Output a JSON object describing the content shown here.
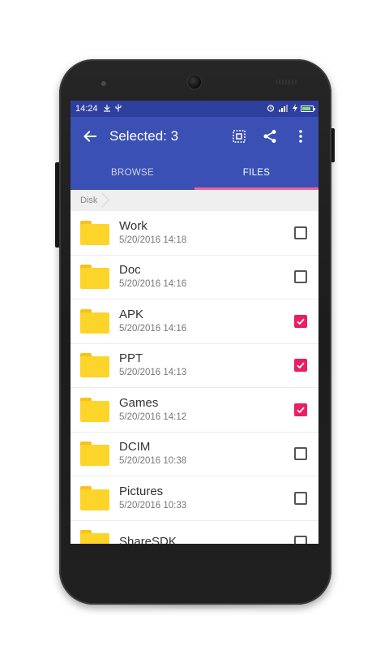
{
  "status_bar": {
    "time": "14:24",
    "left_icons": [
      "usb-icon",
      "usb-debug-icon"
    ],
    "right_icons": [
      "alarm-icon",
      "signal-icon",
      "charging-icon",
      "battery-icon"
    ],
    "battery_fill_fraction": 0.85
  },
  "app_bar": {
    "title": "Selected: 3",
    "actions": [
      "select-all-icon",
      "share-icon",
      "more-vert-icon"
    ]
  },
  "tabs": [
    {
      "label": "BROWSE",
      "active": false
    },
    {
      "label": "FILES",
      "active": true
    }
  ],
  "breadcrumb": {
    "items": [
      "Disk"
    ]
  },
  "files": [
    {
      "name": "Work",
      "date": "5/20/2016 14:18",
      "checked": false
    },
    {
      "name": "Doc",
      "date": "5/20/2016 14:16",
      "checked": false
    },
    {
      "name": "APK",
      "date": "5/20/2016 14:16",
      "checked": true
    },
    {
      "name": "PPT",
      "date": "5/20/2016 14:13",
      "checked": true
    },
    {
      "name": "Games",
      "date": "5/20/2016 14:12",
      "checked": true
    },
    {
      "name": "DCIM",
      "date": "5/20/2016 10:38",
      "checked": false
    },
    {
      "name": "Pictures",
      "date": "5/20/2016 10:33",
      "checked": false
    },
    {
      "name": "ShareSDK",
      "date": "",
      "checked": false
    }
  ],
  "colors": {
    "primary": "#3a50b4",
    "primary_dark": "#2f3f9e",
    "accent": "#e91e63",
    "tab_indicator": "#f06292",
    "folder": "#fdd42a"
  }
}
